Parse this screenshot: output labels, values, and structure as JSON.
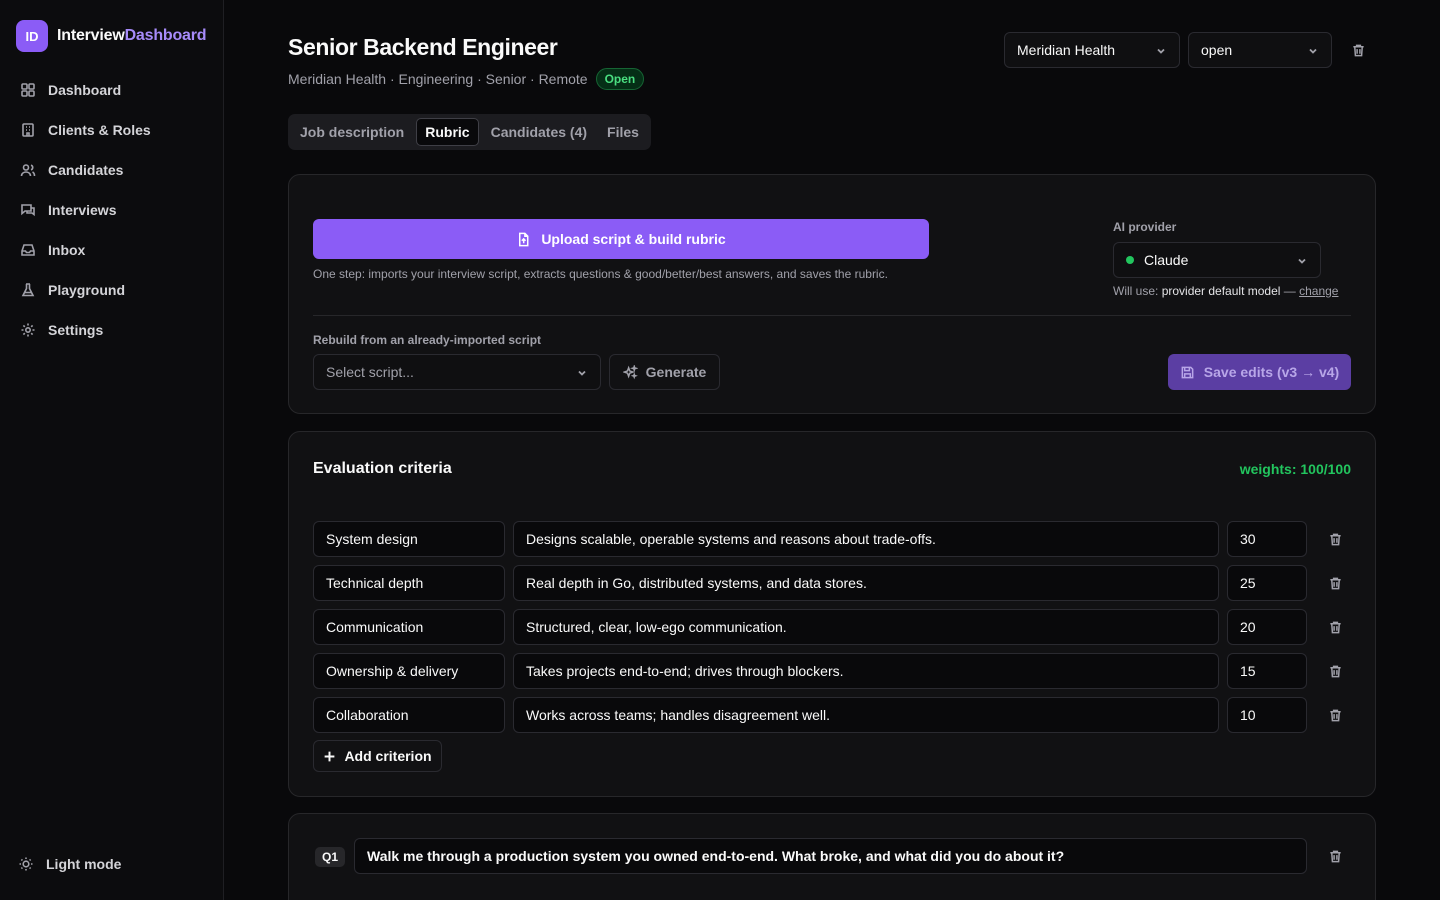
{
  "app": {
    "logo_initials": "ID",
    "logo_name_part1": "Interview",
    "logo_name_part2": "Dashboard"
  },
  "sidebar": {
    "items": [
      {
        "label": "Dashboard",
        "icon": "grid-icon"
      },
      {
        "label": "Clients & Roles",
        "icon": "building-icon"
      },
      {
        "label": "Candidates",
        "icon": "users-icon"
      },
      {
        "label": "Interviews",
        "icon": "message-icon"
      },
      {
        "label": "Inbox",
        "icon": "inbox-icon"
      },
      {
        "label": "Playground",
        "icon": "flask-icon"
      },
      {
        "label": "Settings",
        "icon": "gear-icon"
      }
    ],
    "light_mode_label": "Light mode"
  },
  "header": {
    "title": "Senior Backend Engineer",
    "subtitle": "Meridian Health · Engineering · Senior · Remote",
    "status_badge": "Open",
    "client_select": "Meridian Health",
    "status_select": "open"
  },
  "tabs": [
    {
      "label": "Job description",
      "active": false
    },
    {
      "label": "Rubric",
      "active": true
    },
    {
      "label": "Candidates (4)",
      "active": false
    },
    {
      "label": "Files",
      "active": false
    }
  ],
  "rubric_builder": {
    "upload_label": "Upload script & build rubric",
    "upload_hint": "One step: imports your interview script, extracts questions & good/better/best answers, and saves the rubric.",
    "provider_label": "AI provider",
    "provider_value": "Claude",
    "will_use_prefix": "Will use:",
    "will_use_model": "provider default model",
    "will_use_sep": "—",
    "change_link": "change",
    "rebuild_label": "Rebuild from an already-imported script",
    "script_placeholder": "Select script...",
    "generate_label": "Generate",
    "save_label": "Save edits (v3 → v4)"
  },
  "criteria": {
    "title": "Evaluation criteria",
    "weights_summary": "weights: 100/100",
    "items": [
      {
        "name": "System design",
        "description": "Designs scalable, operable systems and reasons about trade-offs.",
        "weight": "30"
      },
      {
        "name": "Technical depth",
        "description": "Real depth in Go, distributed systems, and data stores.",
        "weight": "25"
      },
      {
        "name": "Communication",
        "description": "Structured, clear, low-ego communication.",
        "weight": "20"
      },
      {
        "name": "Ownership & delivery",
        "description": "Takes projects end-to-end; drives through blockers.",
        "weight": "15"
      },
      {
        "name": "Collaboration",
        "description": "Works across teams; handles disagreement well.",
        "weight": "10"
      }
    ],
    "add_label": "Add criterion"
  },
  "questions": [
    {
      "badge": "Q1",
      "text": "Walk me through a production system you owned end-to-end. What broke, and what did you do about it?"
    }
  ],
  "colors": {
    "accent": "#8b5cf6",
    "success": "#22c55e",
    "background": "#09090b"
  }
}
